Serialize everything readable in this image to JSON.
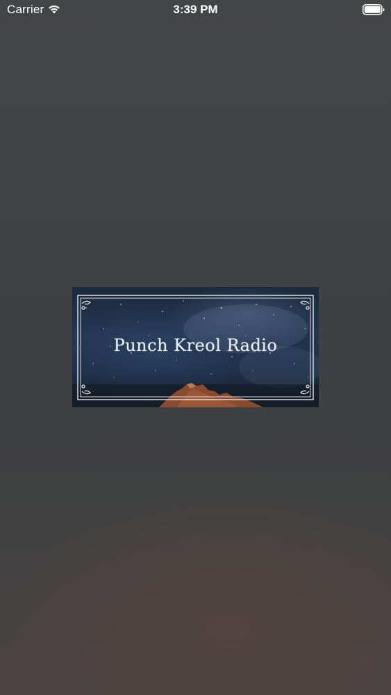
{
  "status_bar": {
    "carrier": "Carrier",
    "time": "3:39 PM",
    "wifi_icon": "wifi-icon",
    "battery_icon": "battery-icon"
  },
  "banner": {
    "title": "Punch Kreol Radio"
  },
  "colors": {
    "background_top": "#444547",
    "background_bottom": "#4a4343",
    "banner_sky": "#223550",
    "mountain": "#8a4a30",
    "frame_line": "#e8e8e8"
  }
}
